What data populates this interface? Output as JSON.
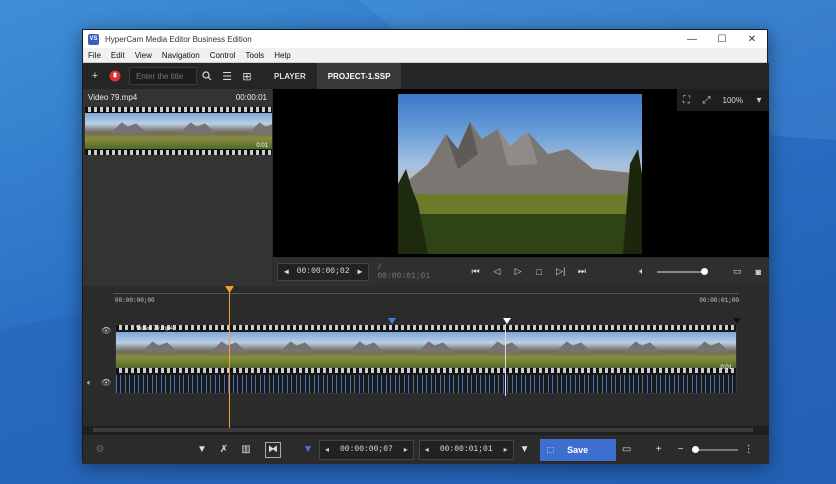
{
  "window": {
    "app_icon": "VS",
    "title": "HyperCam Media Editor Business Edition",
    "controls": {
      "minimize": "—",
      "maximize": "☐",
      "close": "✕"
    }
  },
  "menu": [
    "File",
    "Edit",
    "View",
    "Navigation",
    "Control",
    "Tools",
    "Help"
  ],
  "toolbar": {
    "search_placeholder": "Enter the title",
    "tabs": [
      {
        "label": "PLAYER",
        "active": false
      },
      {
        "label": "PROJECT-1.SSP",
        "active": true
      }
    ]
  },
  "media_panel": {
    "file_name": "Video 79.mp4",
    "file_duration": "00:00:01",
    "thumb_duration": "0:01"
  },
  "preview": {
    "zoom": "100%"
  },
  "transport": {
    "current_time": "00:00:00;02",
    "total_time": "/ 00:00:01;01",
    "volume": 1.0
  },
  "timeline": {
    "ruler_start": "00:00:00;00",
    "ruler_end": "00:00:01;00",
    "clip_name": "Video 79.mp4",
    "clip_end_label": "0:01"
  },
  "bottombar": {
    "start_time": "00:00:00;07",
    "end_time": "00:00:01;01",
    "save_label": "Save",
    "zoom": 0.0
  },
  "colors": {
    "accent": "#3c6fd0",
    "playhead": "#f0a030",
    "desktop": "#2a6fc4"
  }
}
